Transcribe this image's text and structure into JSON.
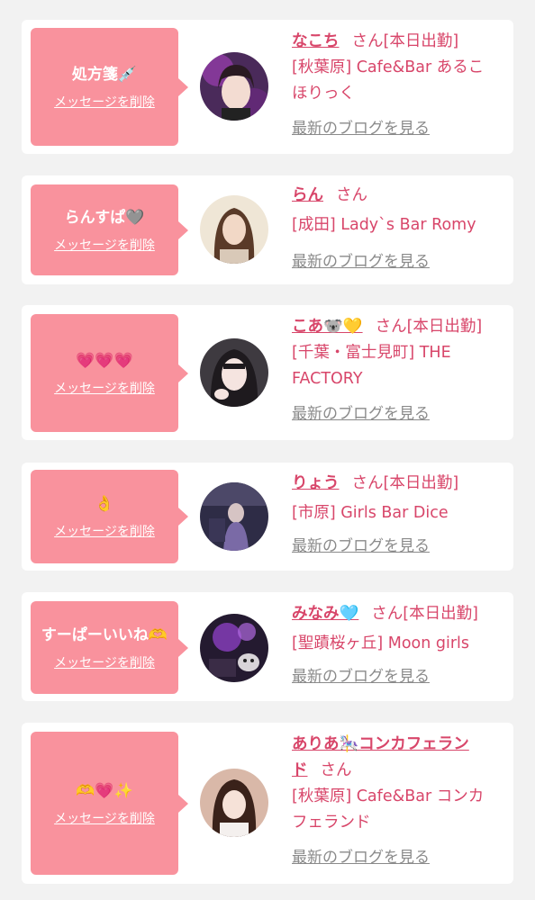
{
  "delete_label": "メッセージを削除",
  "blog_label": "最新のブログを見る",
  "san_label": "さん",
  "cards": [
    {
      "message": "処方箋💉",
      "name": "なこち",
      "status": "[本日出勤]",
      "shop_line1": "[秋葉原] Cafe&Bar あるこ",
      "shop_line2": "ほりっく"
    },
    {
      "message": "らんすぱ🩶",
      "name": "らん",
      "status": "",
      "shop_line1": "[成田] Lady`s Bar Romy",
      "shop_line2": ""
    },
    {
      "message": "💗💗💗",
      "name": "こあ🐨💛",
      "status": "[本日出勤]",
      "shop_line1": "[千葉・富士見町] THE",
      "shop_line2": "FACTORY"
    },
    {
      "message": "👌",
      "name": "りょう",
      "status": "[本日出勤]",
      "shop_line1": "[市原] Girls Bar Dice",
      "shop_line2": ""
    },
    {
      "message": "すーぱーいいね🫶",
      "name": "みなみ🩵",
      "status": "[本日出勤]",
      "shop_line1": "[聖蹟桜ヶ丘] Moon girls",
      "shop_line2": ""
    },
    {
      "message": "🫶💗✨",
      "name_line1": "ありあ🎠コンカフェラン",
      "name_line2": "ド",
      "status": "",
      "shop_line1": "[秋葉原] Cafe&Bar コンカ",
      "shop_line2": "フェランド"
    }
  ],
  "colors": {
    "accent_pink": "#f9929d",
    "name_pink": "#d8466a",
    "link_gray": "#8a8a8a",
    "bg": "#f2f2f2"
  },
  "icons": [
    "avatar-photo"
  ]
}
